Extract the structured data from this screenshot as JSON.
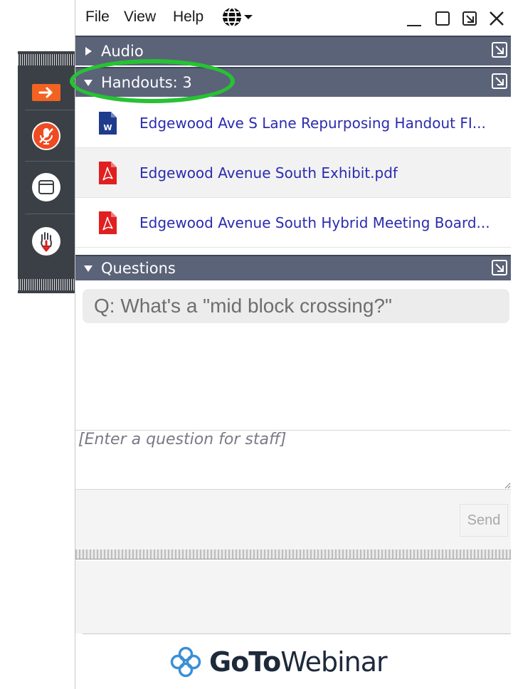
{
  "menu": {
    "file": "File",
    "view": "View",
    "help": "Help"
  },
  "sections": {
    "audio": {
      "label": "Audio"
    },
    "handouts": {
      "label": "Handouts: 3",
      "items": [
        {
          "name": "Edgewood Ave S Lane Repurposing Handout FI...",
          "type": "word"
        },
        {
          "name": "Edgewood Avenue South Exhibit.pdf",
          "type": "pdf"
        },
        {
          "name": "Edgewood Avenue South Hybrid Meeting Board...",
          "type": "pdf"
        }
      ]
    },
    "questions": {
      "label": "Questions",
      "items": [
        "Q: What's a \"mid block crossing?\""
      ],
      "input_placeholder": "[Enter a question for staff]",
      "send_label": "Send"
    }
  },
  "brand": {
    "bold": "GoTo",
    "regular": "Webinar"
  },
  "colors": {
    "section_bar": "#5b6378",
    "link": "#2b2bb0",
    "highlight": "#27c234",
    "accent_orange": "#f26322",
    "mic_red": "#f04a23",
    "strip": "#3b4046"
  }
}
